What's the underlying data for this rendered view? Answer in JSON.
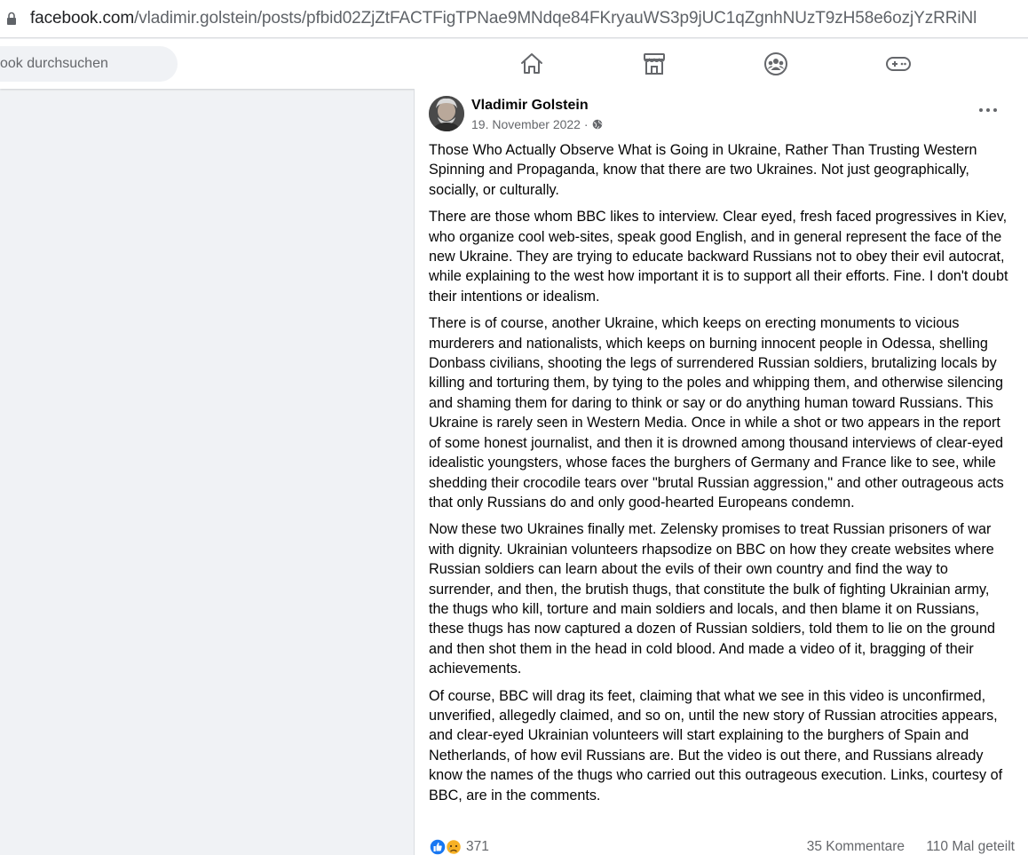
{
  "browser": {
    "url_host": "facebook.com",
    "url_path": "/vladimir.golstein/posts/pfbid02ZjZtFACTFigTPNae9MNdqe84FKryauWS3p9jUC1qZgnhNUzT9zH58e6ozjYzRRiNl"
  },
  "nav": {
    "search_placeholder": "ook durchsuchen",
    "icons": [
      "home-icon",
      "marketplace-icon",
      "groups-icon",
      "gaming-icon"
    ]
  },
  "post": {
    "author": "Vladimir Golstein",
    "date": "19. November 2022 ·",
    "paragraphs": [
      "Those Who Actually Observe What is Going in Ukraine, Rather Than Trusting Western Spinning and Propaganda, know that there are two Ukraines. Not just geographically, socially, or culturally.",
      "There are those whom BBC likes to interview. Clear eyed, fresh faced progressives in Kiev, who organize cool web-sites, speak good English, and in general represent the face of the new Ukraine. They are trying to educate backward Russians not to obey their evil autocrat, while explaining to the west how important it is to support all their efforts. Fine. I don't doubt their intentions or idealism.",
      "There is of course, another Ukraine, which keeps on erecting monuments to vicious murderers and nationalists, which keeps on burning innocent people in Odessa, shelling Donbass civilians, shooting the legs of surrendered Russian soldiers, brutalizing locals by killing and torturing them, by tying to the poles and whipping them, and otherwise silencing and shaming them for daring to think or say or do anything human toward Russians. This Ukraine is rarely seen in Western Media. Once in while a shot or two appears in the report of some honest journalist, and then it is drowned among thousand interviews of clear-eyed idealistic youngsters, whose faces the burghers of Germany and France like to see, while shedding their crocodile tears over \"brutal Russian aggression,\" and other outrageous acts that only Russians do and only good-hearted Europeans condemn.",
      "Now these two Ukraines finally met. Zelensky promises to treat Russian prisoners of war with dignity. Ukrainian volunteers rhapsodize on BBC on how they create websites where Russian soldiers can learn about the evils of their own country and find the way to surrender, and then, the brutish thugs, that constitute the bulk of fighting Ukrainian army, the thugs who kill, torture and main soldiers and locals, and then blame it on Russians, these thugs has now captured a dozen of Russian soldiers, told them to lie on the ground and then shot them in the head in cold blood. And made a video of it, bragging of their achievements.",
      "Of course, BBC will drag its feet, claiming that what we see in this video is unconfirmed, unverified, allegedly claimed, and so on, until the new story of Russian atrocities appears, and clear-eyed Ukrainian volunteers will start explaining to the burghers of Spain and Netherlands, of how evil Russians are. But the video is out there, and Russians already know the names of the thugs who carried out this outrageous execution. Links, courtesy of BBC, are in the comments."
    ],
    "reactions_count": "371",
    "comments": "35 Kommentare",
    "shares": "110 Mal geteilt"
  },
  "colors": {
    "like_blue": "#1877f2",
    "sad_yellow": "#f7b125",
    "secondary_text": "#65676b"
  }
}
